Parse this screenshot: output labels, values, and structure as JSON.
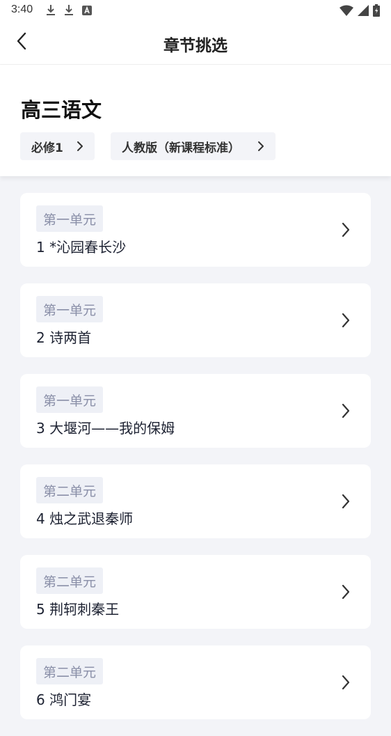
{
  "status_bar": {
    "time": "3:40",
    "left_icons": [
      "download-icon",
      "download-icon",
      "text-a-icon"
    ],
    "right_icons": [
      "wifi-icon",
      "signal-icon",
      "battery-icon"
    ]
  },
  "header": {
    "title": "章节挑选",
    "back_icon": "chevron-left-icon"
  },
  "subject": {
    "title": "高三语文",
    "filters": [
      {
        "label": "必修1"
      },
      {
        "label": "人教版（新课程标准）"
      }
    ]
  },
  "chapters": [
    {
      "unit": "第一单元",
      "name": "1 *沁园春长沙"
    },
    {
      "unit": "第一单元",
      "name": "2 诗两首"
    },
    {
      "unit": "第一单元",
      "name": "3 大堰河——我的保姆"
    },
    {
      "unit": "第二单元",
      "name": "4 烛之武退秦师"
    },
    {
      "unit": "第二单元",
      "name": "5 荆轲刺秦王"
    },
    {
      "unit": "第二单元",
      "name": "6 鸿门宴"
    }
  ],
  "colors": {
    "background": "#f3f4f8",
    "card": "#ffffff",
    "unit_tag_bg": "#eef0f6",
    "unit_tag_text": "#8a8fa8"
  }
}
